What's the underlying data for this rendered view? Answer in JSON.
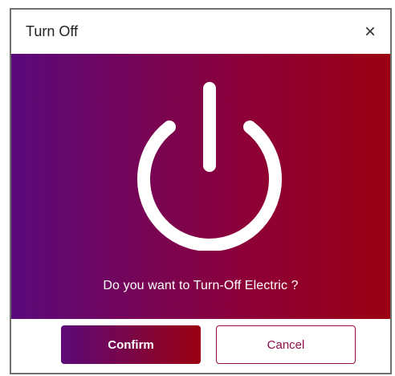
{
  "dialog": {
    "title": "Turn Off",
    "close_symbol": "×",
    "question": "Do you want to Turn-Off Electric ?",
    "icon": "power-icon",
    "confirm_label": "Confirm",
    "cancel_label": "Cancel",
    "colors": {
      "gradient_start": "#5a0a7c",
      "gradient_end": "#9b0012",
      "cancel_accent": "#8d0e4a",
      "icon": "#ffffff"
    }
  }
}
